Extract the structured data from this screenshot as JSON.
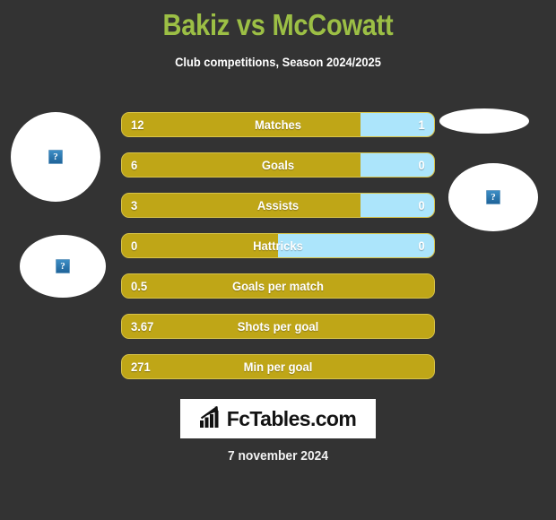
{
  "header": {
    "title": "Bakiz vs McCowatt",
    "subtitle": "Club competitions, Season 2024/2025"
  },
  "colors": {
    "background": "#333333",
    "title_green": "#9CBF45",
    "home_gold": "#BFA617",
    "home_gold_border": "#D8C44A",
    "away_blue": "#ACE5FB",
    "text_white": "#FFFFFF"
  },
  "photos": [
    {
      "name": "player-photo-left-large",
      "icon": "broken-image-icon",
      "glyph": "?"
    },
    {
      "name": "player-photo-left-small",
      "icon": "broken-image-icon",
      "glyph": "?"
    },
    {
      "name": "player-photo-right-top",
      "icon": "none",
      "glyph": ""
    },
    {
      "name": "player-photo-right-large",
      "icon": "broken-image-icon",
      "glyph": "?"
    }
  ],
  "stats": [
    {
      "label": "Matches",
      "home": "12",
      "away": "1",
      "home_pct": 76.5,
      "split": true
    },
    {
      "label": "Goals",
      "home": "6",
      "away": "0",
      "home_pct": 76.5,
      "split": true
    },
    {
      "label": "Assists",
      "home": "3",
      "away": "0",
      "home_pct": 76.5,
      "split": true
    },
    {
      "label": "Hattricks",
      "home": "0",
      "away": "0",
      "home_pct": 50.0,
      "split": true
    },
    {
      "label": "Goals per match",
      "home": "0.5",
      "away": "",
      "home_pct": 100,
      "split": false
    },
    {
      "label": "Shots per goal",
      "home": "3.67",
      "away": "",
      "home_pct": 100,
      "split": false
    },
    {
      "label": "Min per goal",
      "home": "271",
      "away": "",
      "home_pct": 100,
      "split": false
    }
  ],
  "footer": {
    "logo_text": "FcTables.com",
    "logo_icon": "bar-chart-growth-icon",
    "date": "7 november 2024"
  }
}
